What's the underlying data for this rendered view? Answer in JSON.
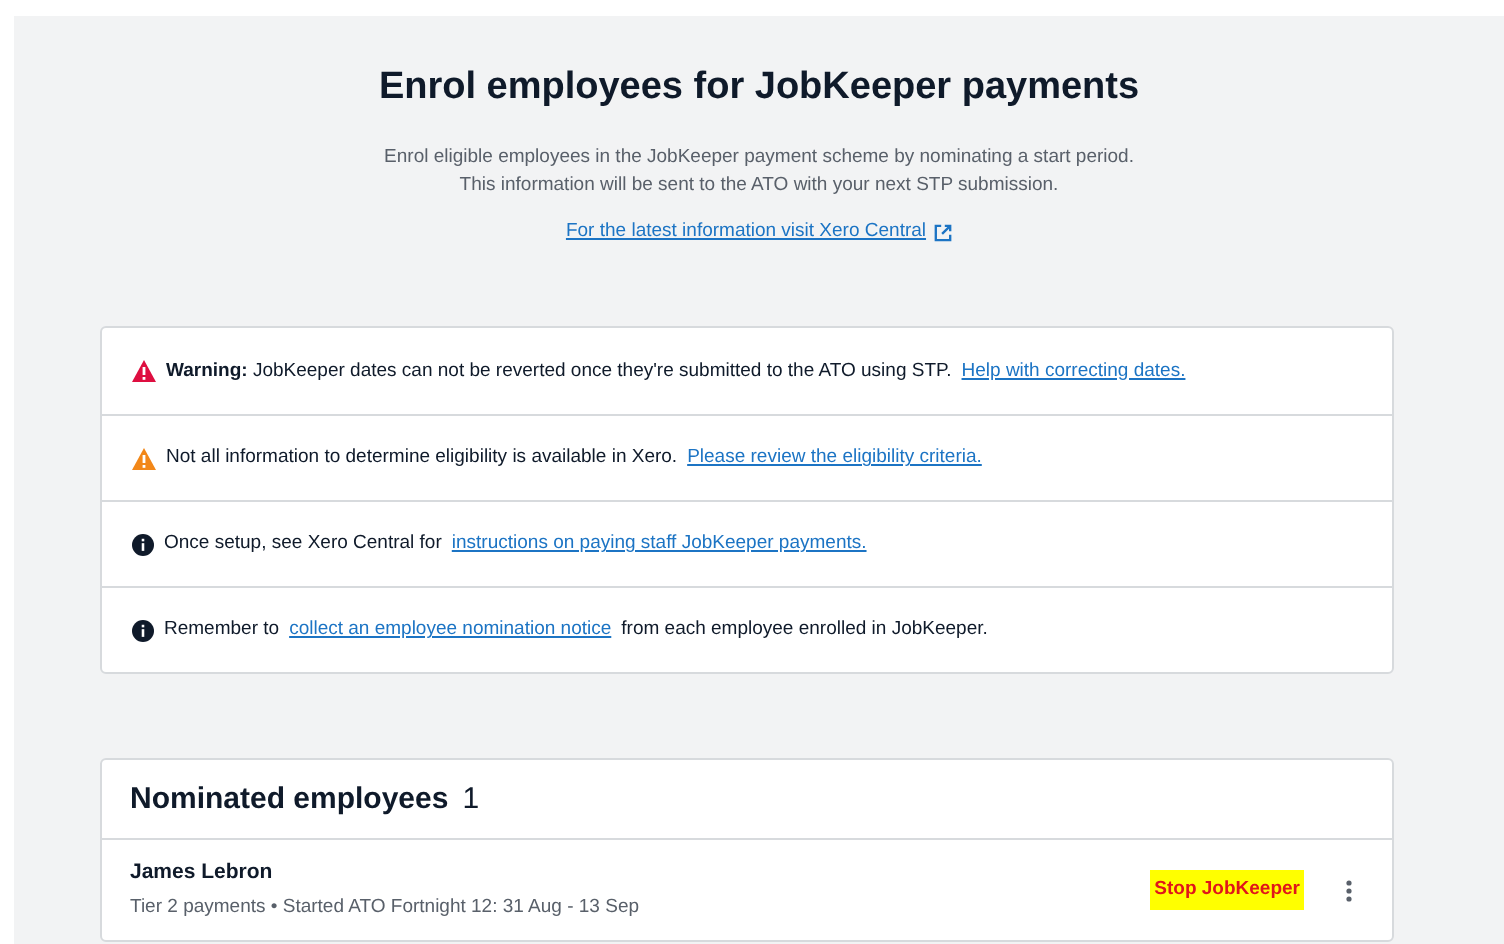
{
  "header": {
    "title": "Enrol employees for JobKeeper payments",
    "description": [
      "Enrol eligible employees in the JobKeeper payment scheme by nominating a start period.",
      "This information will be sent to the ATO with your next STP submission."
    ],
    "link": "For the latest information visit Xero Central"
  },
  "notices": [
    {
      "kind": "warning",
      "before": "**Warning:** JobKeeper dates can not be reverted once they're submitted to the ATO using STP.",
      "link": "Help with correcting dates."
    },
    {
      "kind": "caution",
      "before": "Not all information to determine eligibility is available in Xero.",
      "link": "Please review the eligibility criteria."
    },
    {
      "kind": "info",
      "before": "Once setup, see Xero Central for",
      "link": "instructions on paying staff JobKeeper payments."
    },
    {
      "kind": "info",
      "before": "Remember to",
      "link": "collect an employee nomination notice",
      "after": "from each employee enrolled in JobKeeper."
    }
  ],
  "nominated": {
    "title": "Nominated employees",
    "count": "1",
    "employees": [
      {
        "name": "James Lebron",
        "details": "Tier 2 payments • Started ATO Fortnight 12: 31 Aug - 13 Sep",
        "action": "Stop JobKeeper",
        "highlighted": true
      }
    ]
  }
}
